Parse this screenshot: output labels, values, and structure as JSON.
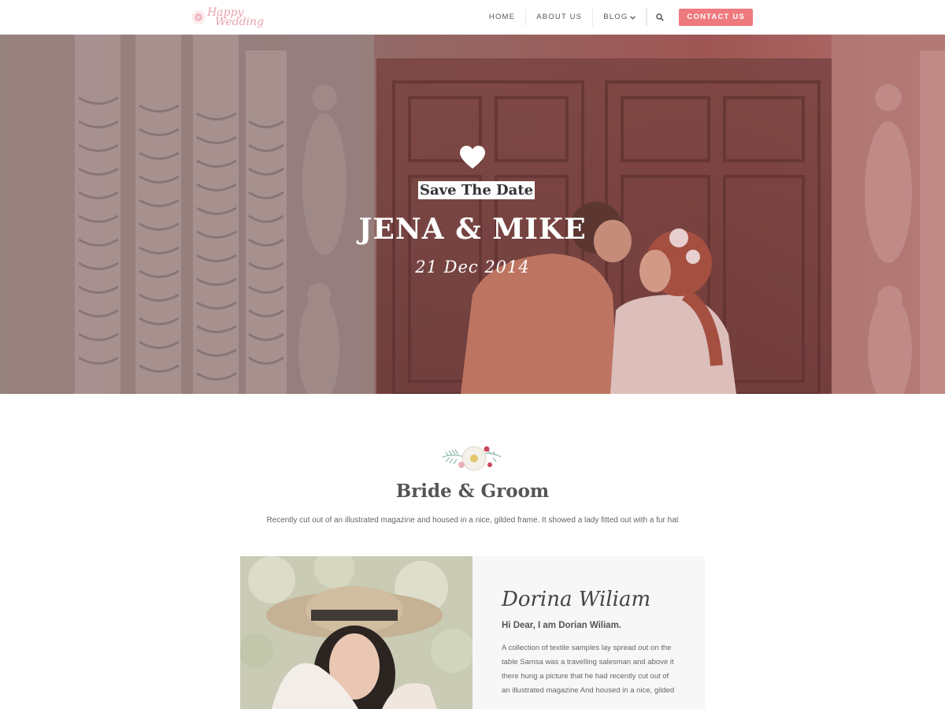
{
  "brand": {
    "logo_line1": "Happy",
    "logo_line2": "Wedding"
  },
  "nav": {
    "items": [
      {
        "label": "HOME"
      },
      {
        "label": "ABOUT US"
      },
      {
        "label": "BLOG",
        "chevron": "chevron-down-icon"
      }
    ],
    "search_icon": "search-icon",
    "contact_label": "CONTACT US"
  },
  "hero": {
    "icon": "heart-icon",
    "tagline": "Save The Date",
    "couple": "JENA & MIKE",
    "date": "21 Dec 2014"
  },
  "section": {
    "icon": "floral-ornament",
    "title": "Bride & Groom",
    "subtitle": "Recently cut out of an illustrated magazine and housed in a nice, gilded frame. It showed a lady fitted out with a fur hat"
  },
  "profile": {
    "name": "Dorina Wiliam",
    "greeting": "Hi Dear, I am Dorian Wiliam.",
    "bio_lines": [
      "A collection of textile samples lay spread out on the",
      "table Samsa was a travelling salesman and above it",
      "there hung a picture that he had recently cut out of",
      "an illustrated magazine And housed in a nice, gilded"
    ]
  },
  "colors": {
    "accent": "#ef7a7e",
    "logo": "#e9a3ad",
    "overlay": "#b4605f"
  }
}
